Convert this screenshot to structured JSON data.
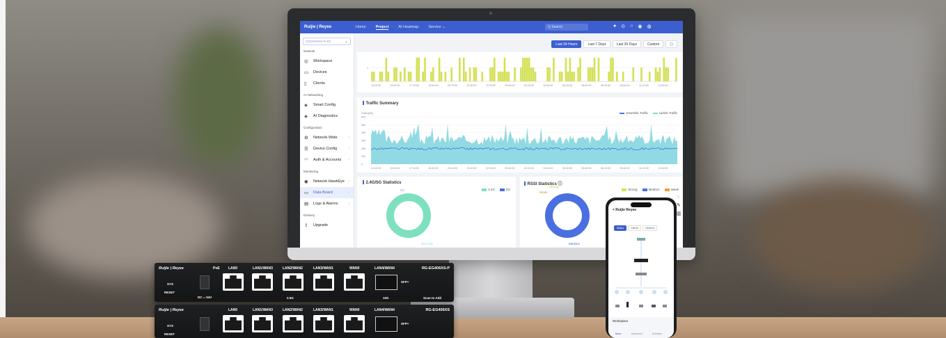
{
  "app": {
    "logo": "Ruijie | Reyee"
  },
  "nav": [
    "Home",
    "Project",
    "AI Heatmap",
    "Service ⌄"
  ],
  "search_placeholder": "Q Search",
  "sidebar": {
    "select": "XXXXXXXX-P-XX",
    "sections": [
      {
        "title": "Network",
        "items": [
          "Workspace",
          "Devices",
          "Clients"
        ]
      },
      {
        "title": "AI Networking",
        "items": [
          "Smart Config",
          "AI Diagnostics"
        ]
      },
      {
        "title": "Configuration",
        "items": [
          "Network-Wide",
          "Device Config",
          "Auth & Accounts"
        ]
      },
      {
        "title": "Monitoring",
        "items": [
          "Network HawkEye",
          "Data Board",
          "Logs & Alarms"
        ]
      },
      {
        "title": "Delivery",
        "items": [
          "Upgrade"
        ]
      }
    ]
  },
  "filters": [
    "Last 24 Hours",
    "Last 7 Days",
    "Last 30 Days",
    "Custom"
  ],
  "chart1": {
    "ticks": [
      "14:10:00",
      "15:40:00",
      "17:10:00",
      "18:40:00",
      "20:10:00",
      "21:40:00",
      "22:10:00",
      "00:40:00",
      "02:10:00",
      "03:40:00",
      "05:10:00",
      "06:40:00",
      "08:10:00",
      "09:40:00",
      "11:10:00",
      "12:40:00"
    ]
  },
  "traffic": {
    "title": "Traffic Summary",
    "unit": "Traffic(KB)",
    "legend": [
      "Downlink Traffic",
      "Uplink Traffic"
    ],
    "yticks": [
      "600",
      "500",
      "400",
      "300",
      "200",
      "100",
      "0"
    ]
  },
  "band": {
    "title": "2.4G/5G Statistics",
    "legend": [
      "2.4G",
      "5G"
    ],
    "label_top": "5G",
    "label_bottom": "5G 2.4G"
  },
  "rssi": {
    "title": "RSSI Statistics ⓘ",
    "legend": [
      "Strong",
      "Medium",
      "Weak"
    ],
    "label_top": "Strong",
    "label_left": "Weak",
    "label_bottom": "Medium"
  },
  "phone": {
    "title": "< Ruijie Reyee",
    "tabs": [
      "Status",
      "Clients",
      "Network"
    ],
    "bottom": "Workspace",
    "bottom_tabs": [
      "Basic",
      "Advanced",
      "Scenario"
    ]
  },
  "router1": {
    "brand": "Ruijie | Reyee",
    "model": "RG-EG406XS-P",
    "labels": [
      "PoE",
      "LAN0",
      "LAN1/WAN3",
      "LAN2/WAN2",
      "LAN3/WAN1",
      "WAN0",
      "LAN4/WAN4"
    ],
    "sys": "SYS",
    "reset": "RESET",
    "dc": "DC ═ 54V",
    "g25": "2.5G",
    "g10": "10G",
    "sfp": "SFP+",
    "scan": "Scan to Add"
  },
  "router2": {
    "brand": "Ruijie | Reyee",
    "model": "RG-EG406XS",
    "labels": [
      "LAN0",
      "LAN1/WAN3",
      "LAN2/WAN2",
      "LAN3/WAN1",
      "WAN0",
      "LAN4/WAN4"
    ],
    "sys": "SYS",
    "reset": "RESET",
    "sfp": "SFP+"
  },
  "colors": {
    "primary": "#3b5fcf",
    "bar": "#d4e157",
    "traffic": "#7fd3de",
    "green": "#7ee0c0",
    "blue": "#4a6fe0",
    "orange": "#f0a030"
  }
}
